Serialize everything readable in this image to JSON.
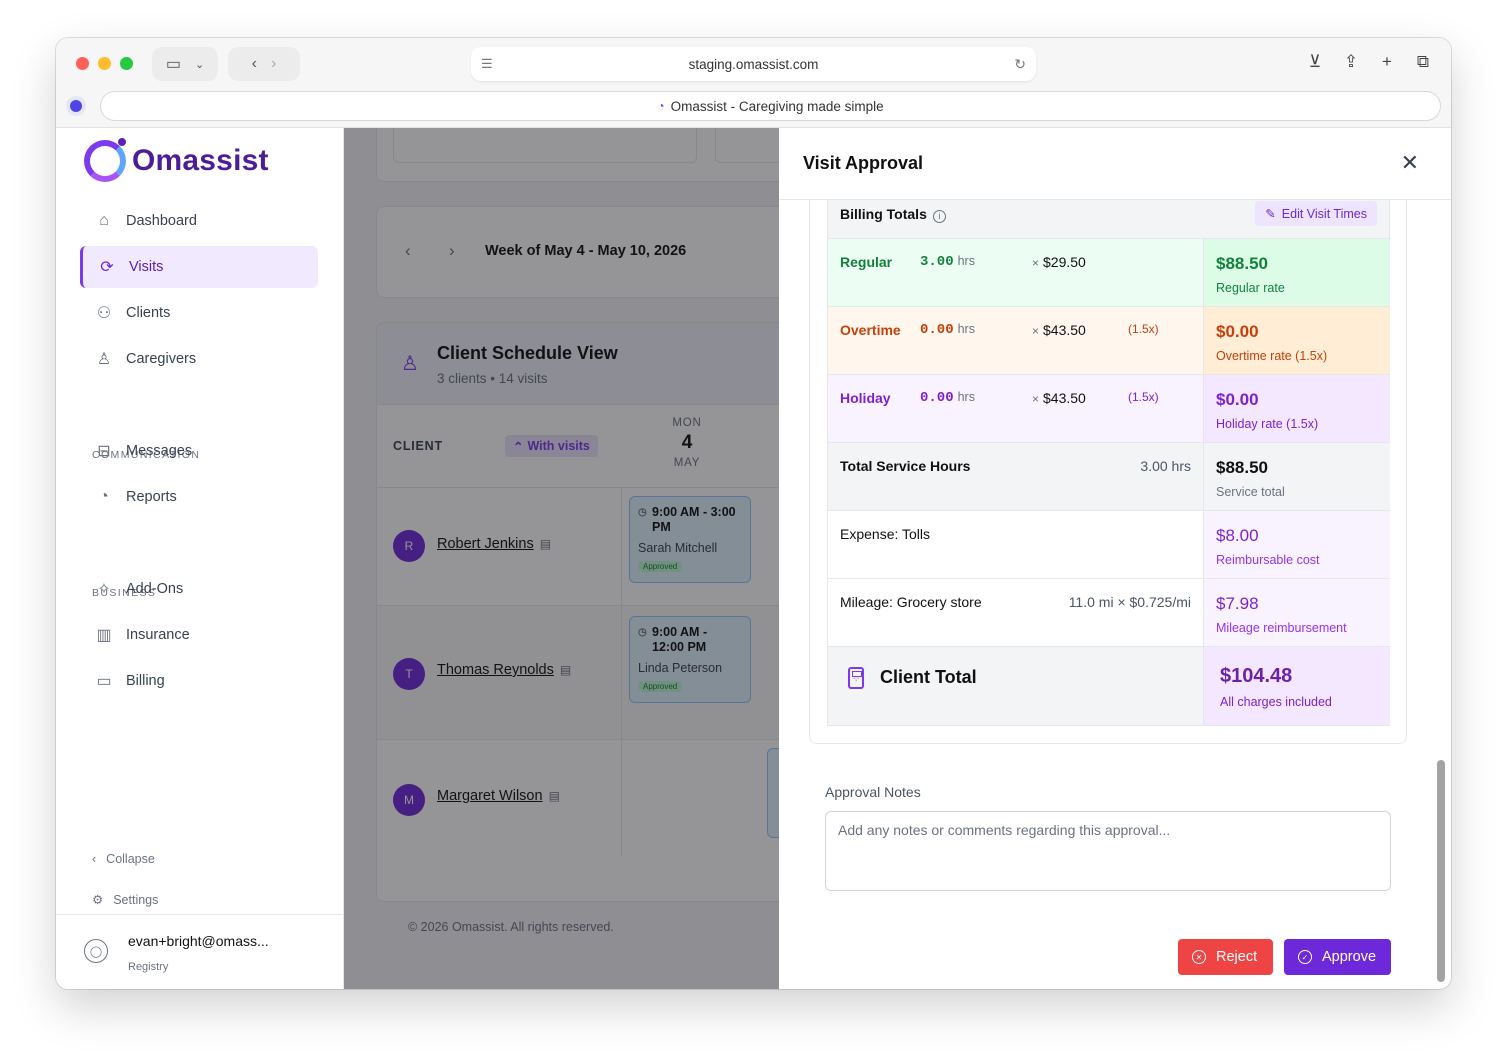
{
  "browser": {
    "url": "staging.omassist.com",
    "tab_title": "Omassist - Caregiving made simple"
  },
  "sidebar": {
    "brand": "Omassist",
    "nav": [
      {
        "label": "Dashboard",
        "icon": "home-icon"
      },
      {
        "label": "Visits",
        "icon": "refresh-icon",
        "active": true
      },
      {
        "label": "Clients",
        "icon": "users-icon"
      },
      {
        "label": "Caregivers",
        "icon": "user-icon"
      }
    ],
    "section_communication": "COMMUNICATION",
    "communication": [
      {
        "label": "Messages",
        "icon": "inbox-icon"
      },
      {
        "label": "Reports",
        "icon": "pie-chart-icon"
      }
    ],
    "section_business": "BUSINESS",
    "business": [
      {
        "label": "Add-Ons",
        "icon": "sparkles-icon"
      },
      {
        "label": "Insurance",
        "icon": "building-icon"
      },
      {
        "label": "Billing",
        "icon": "credit-card-icon"
      }
    ],
    "collapse": "Collapse",
    "settings": "Settings",
    "user": {
      "email": "evan+bright@omass...",
      "role": "Registry"
    }
  },
  "schedule": {
    "week": "Week of May 4 - May 10, 2026",
    "title": "Client Schedule View",
    "subtitle": "3 clients • 14 visits",
    "col_client": "CLIENT",
    "filter": "With visits",
    "day": {
      "dow": "MON",
      "num": "4",
      "month": "MAY"
    },
    "clients": [
      {
        "initial": "R",
        "name": "Robert Jenkins",
        "visit": {
          "time": "9:00 AM - 3:00 PM",
          "caregiver": "Sarah Mitchell",
          "status": "Approved"
        }
      },
      {
        "initial": "T",
        "name": "Thomas Reynolds",
        "visit": {
          "time": "9:00 AM - 12:00 PM",
          "caregiver": "Linda Peterson",
          "status": "Approved"
        }
      },
      {
        "initial": "M",
        "name": "Margaret Wilson"
      }
    ],
    "copyright": "© 2026 Omassist. All rights reserved."
  },
  "panel": {
    "title": "Visit Approval",
    "billing_title": "Billing Totals",
    "edit_button": "Edit Visit Times",
    "rows": {
      "regular": {
        "label": "Regular",
        "hours": "3.00",
        "hrs_unit": "hrs",
        "rate": "$29.50",
        "amount": "$88.50",
        "sub": "Regular rate"
      },
      "overtime": {
        "label": "Overtime",
        "hours": "0.00",
        "hrs_unit": "hrs",
        "rate": "$43.50",
        "mult": "(1.5x)",
        "amount": "$0.00",
        "sub": "Overtime rate (1.5x)"
      },
      "holiday": {
        "label": "Holiday",
        "hours": "0.00",
        "hrs_unit": "hrs",
        "rate": "$43.50",
        "mult": "(1.5x)",
        "amount": "$0.00",
        "sub": "Holiday rate (1.5x)"
      },
      "service": {
        "label": "Total Service Hours",
        "detail": "3.00 hrs",
        "amount": "$88.50",
        "sub": "Service total"
      },
      "expense": {
        "label": "Expense: Tolls",
        "amount": "$8.00",
        "sub": "Reimbursable cost"
      },
      "mileage": {
        "label": "Mileage: Grocery store",
        "detail": "11.0 mi × $0.725/mi",
        "amount": "$7.98",
        "sub": "Mileage reimbursement"
      },
      "total": {
        "label": "Client Total",
        "amount": "$104.48",
        "sub": "All charges included"
      }
    },
    "multiply_sign": "×",
    "notes_label": "Approval Notes",
    "notes_placeholder": "Add any notes or comments regarding this approval...",
    "reject": "Reject",
    "approve": "Approve"
  },
  "colors": {
    "brand": "#6d28d9",
    "regular_bg": "#ecfdf3",
    "overtime_bg": "#fff7ed",
    "holiday_bg": "#f5f0ff",
    "reject": "#ef4444"
  }
}
